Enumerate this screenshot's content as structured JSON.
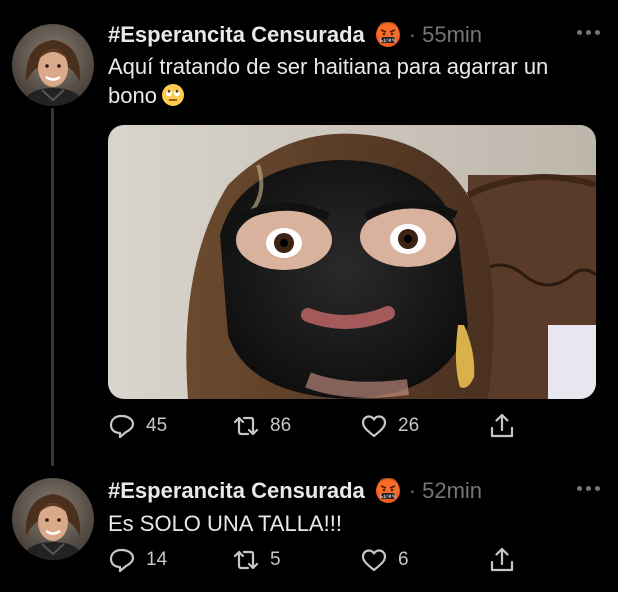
{
  "tweets": [
    {
      "author": "#Esperancita Censurada",
      "badge_icon": "angry-emoji-icon",
      "separator": "·",
      "time": "55min",
      "text": "Aquí tratando de ser haitiana para agarrar un bono",
      "text_emoji": "eye-roll-emoji-icon",
      "media": "photo of woman wearing black face mask",
      "counts": {
        "replies": "45",
        "retweets": "86",
        "likes": "26"
      }
    },
    {
      "author": "#Esperancita Censurada",
      "badge_icon": "angry-emoji-icon",
      "separator": "·",
      "time": "52min",
      "text": "Es SOLO UNA TALLA!!!",
      "counts": {
        "replies": "14",
        "retweets": "5",
        "likes": "6"
      }
    }
  ],
  "colors": {
    "background": "#000000",
    "text": "#e7e9ea",
    "muted": "#71767b",
    "thread_line": "#333639"
  }
}
